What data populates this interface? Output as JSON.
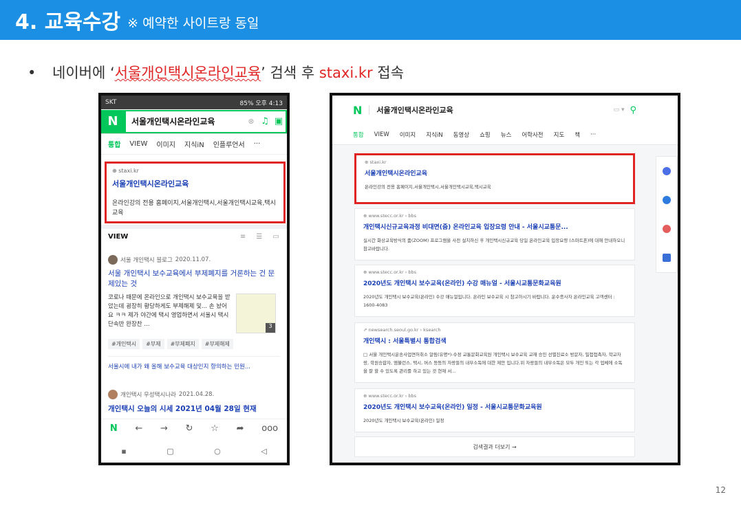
{
  "title": {
    "main": "4. 교육수강",
    "sub": "※ 예약한 사이트랑 동일"
  },
  "bullet": {
    "dot": "•",
    "prefix": "네이버에 ‘",
    "keyword": "서울개인택시온라인교육",
    "middle": "’ 검색 후 ",
    "url": "staxi.kr",
    "suffix": " 접속"
  },
  "colors": {
    "header_blue": "#1a8fe3",
    "naver_green": "#03c75a",
    "highlight_red": "#e02424",
    "link_blue": "#1a3fb5"
  },
  "mobile": {
    "status_left": "SKT",
    "status_right": "85% 오후 4:13",
    "logo": "N",
    "query": "서울개인택시온라인교육",
    "icons": {
      "clear": "close-icon",
      "mic": "mic-icon",
      "lens": "lens-icon"
    },
    "tabs": [
      "통합",
      "VIEW",
      "이미지",
      "지식iN",
      "인플루언서",
      "···"
    ],
    "result": {
      "site": "staxi.kr",
      "title": "서울개인택시온라인교육",
      "desc": "온라인강의 전용 홈페이지,서울개인택시,서울개인택시교육,택시교육"
    },
    "view_label": "VIEW",
    "view_icons": "≡ ☰ ▭",
    "blog1": {
      "author": "서울 개인택시 블로그",
      "date": "2020.11.07.",
      "title": "서울 개인택시 보수교육에서 부제폐지를 거론하는 건 문제있는 것",
      "body": "코로나 때문에 온라인으로 개인택시 보수교육을 받았는데 굉장히 황당하게도 부제해제 및... 손 놨어요 ㅋㅋ 제가 야간에 택시 영업하면서 서울시 택시 단속반 완장찬 ...",
      "thumb_count": "3",
      "tags": [
        "#개인택시",
        "#부제",
        "#부제폐지",
        "#부제해제"
      ],
      "related": "서울시에 내가 왜 올해 보수교육 대상인지 항의하는 민원..."
    },
    "blog2": {
      "author": "개인택시 우성택시나라",
      "date": "2021.04.28.",
      "title": "개인택시 오늘의 시세 2021년 04월 28일 현재"
    },
    "bottom_bar": [
      "N",
      "←",
      "→",
      "↻",
      "☆",
      "➦",
      "ooo"
    ],
    "nav_bar": [
      "▪",
      "▢",
      "○",
      "◁"
    ]
  },
  "desktop": {
    "logo": "N",
    "query": "서울개인택시온라인교육",
    "keyboard": "▭ ▾",
    "search_icon": "search-icon",
    "tabs": [
      "통합",
      "VIEW",
      "이미지",
      "지식iN",
      "동영상",
      "쇼핑",
      "뉴스",
      "어학사전",
      "지도",
      "책",
      "···"
    ],
    "results": [
      {
        "site": "staxi.kr",
        "title": "서울개인택시온라인교육",
        "desc": "온라인강의 전용 홈페이지,서울개인택시,서울개인택시교육,택시교육",
        "highlight": true
      },
      {
        "site": "www.stecc.or.kr › bbs",
        "title": "개인택시신규교육과정 비대면(줌) 온라인교육 입장요령 안내 - 서울시교통문...",
        "desc": "실시간 화상교육방식의 줌(ZOOM) 프로그램을 사전 설치하신 후 개인택시신규교육 당일 온라인교육 입장요령 (스마트폰)에 대해 안내하오니 참고바랍니다.",
        "highlight": false
      },
      {
        "site": "www.stecc.or.kr › bbs",
        "title": "2020년도 개인택시 보수교육(온라인) 수강 매뉴얼 - 서울시교통문화교육원",
        "desc": "2020년도 개인택시 보수교육(온라인) 수강 매뉴얼입니다. 온라인 보수교육 시 참고하시기 바랍니다. 운수종사자 온라인교육 고객센터 : 1600-4083",
        "highlight": false
      },
      {
        "site": "newsearch.seoul.go.kr › ksearch",
        "title": "개인택시 : 서울특별시 통합검색",
        "desc": "□ 서울 개인택시운송사업면허취소 알림(유명*)-수정 교통문화교육원 개인택시 보수교육 교재 승인 선별진료소 방문자, 밀접접촉자, 학교자랑, 학원승합자, 엠뷸런스, 택시, 버스 등등의 자랑들의 내부소독에 대한 제안 입니다.위 자랑들의 내부소독은 모두 개인 또는 각 업체에 소독을 잘 할 수 있도록 관리를 하고 있는 것 현재 서...",
        "highlight": false
      },
      {
        "site": "www.stecc.or.kr › bbs",
        "title": "2020년도 개인택시 보수교육(온라인) 일정 - 서울시교통문화교육원",
        "desc": "2020년도 개인택시 보수교육(온라인) 일정",
        "highlight": false
      }
    ],
    "more_results": "검색결과 더보기 →"
  },
  "page_number": "12"
}
